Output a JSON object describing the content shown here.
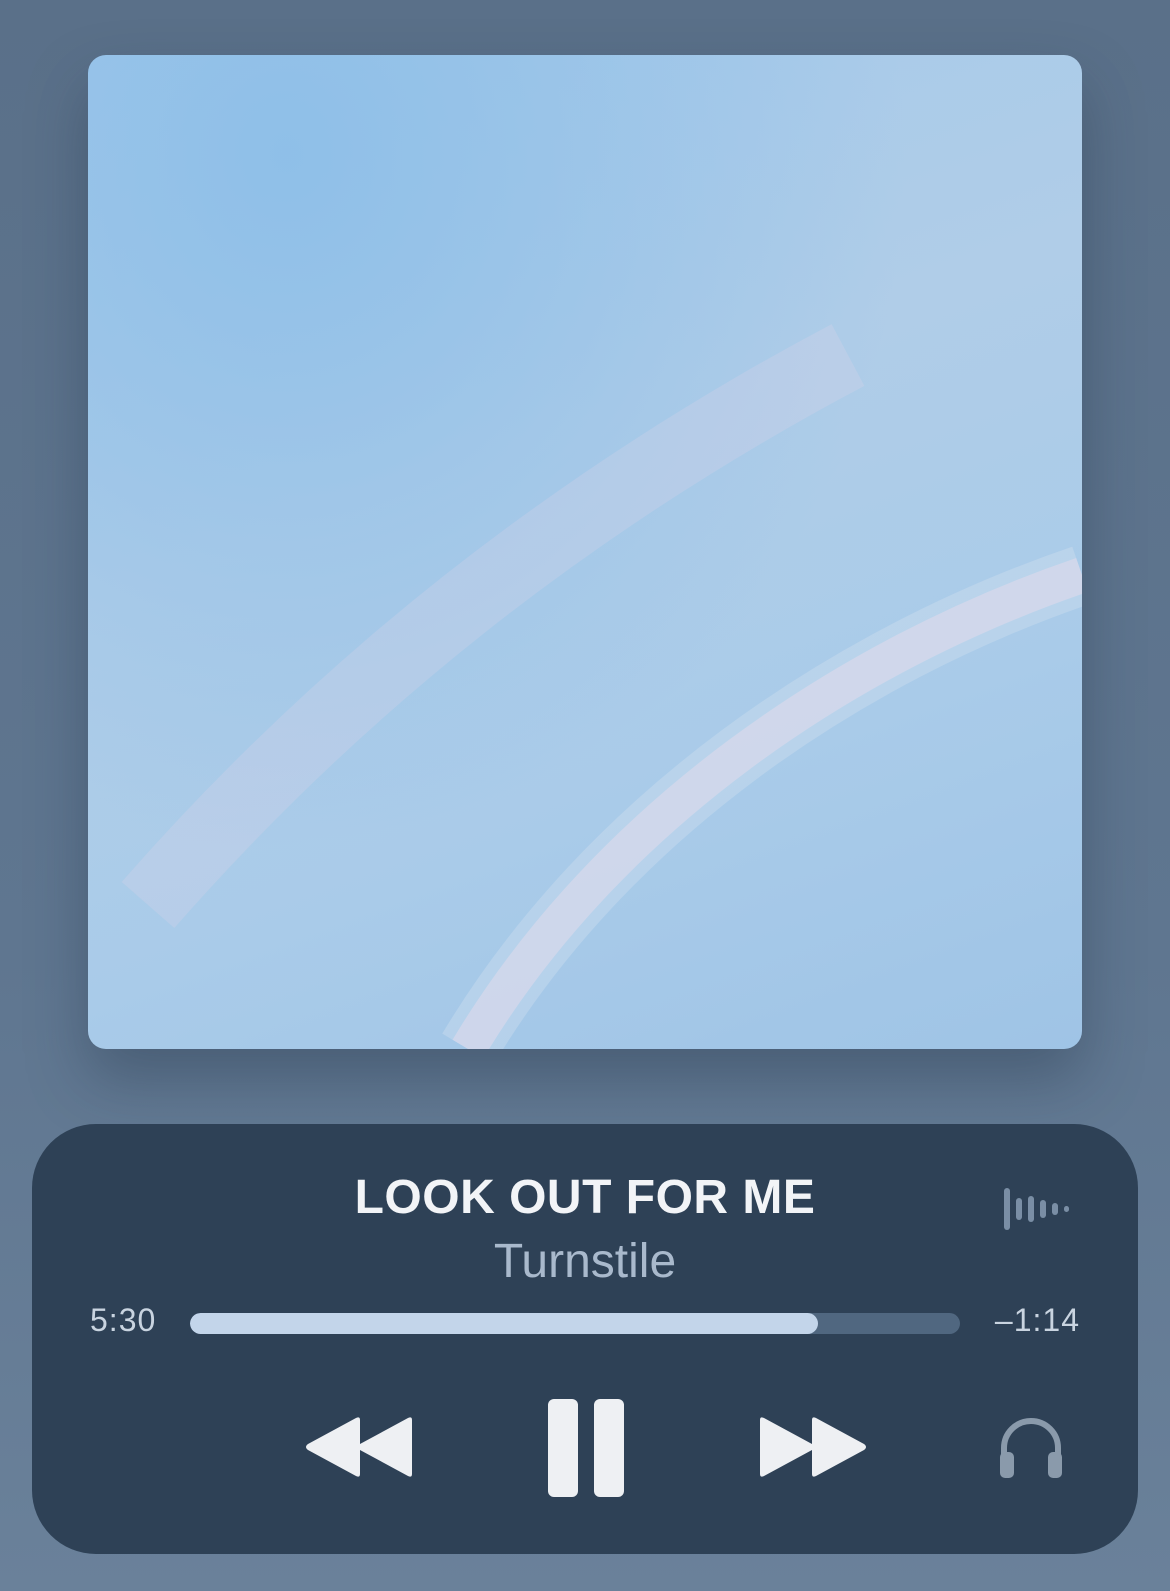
{
  "track": {
    "title": "LOOK OUT FOR ME",
    "artist": "Turnstile"
  },
  "playback": {
    "elapsed": "5:30",
    "remaining": "–1:14",
    "progress_fraction": 0.816
  },
  "icons": {
    "waveform": "waveform-icon",
    "rewind": "rewind-icon",
    "pause": "pause-icon",
    "forward": "fast-forward-icon",
    "output": "headphones-icon"
  },
  "colors": {
    "panel": "#2e4156",
    "progress_fill": "#c3d5ea",
    "progress_track": "#506780",
    "title": "#f2f4f7",
    "artist": "#a9b9cc"
  }
}
